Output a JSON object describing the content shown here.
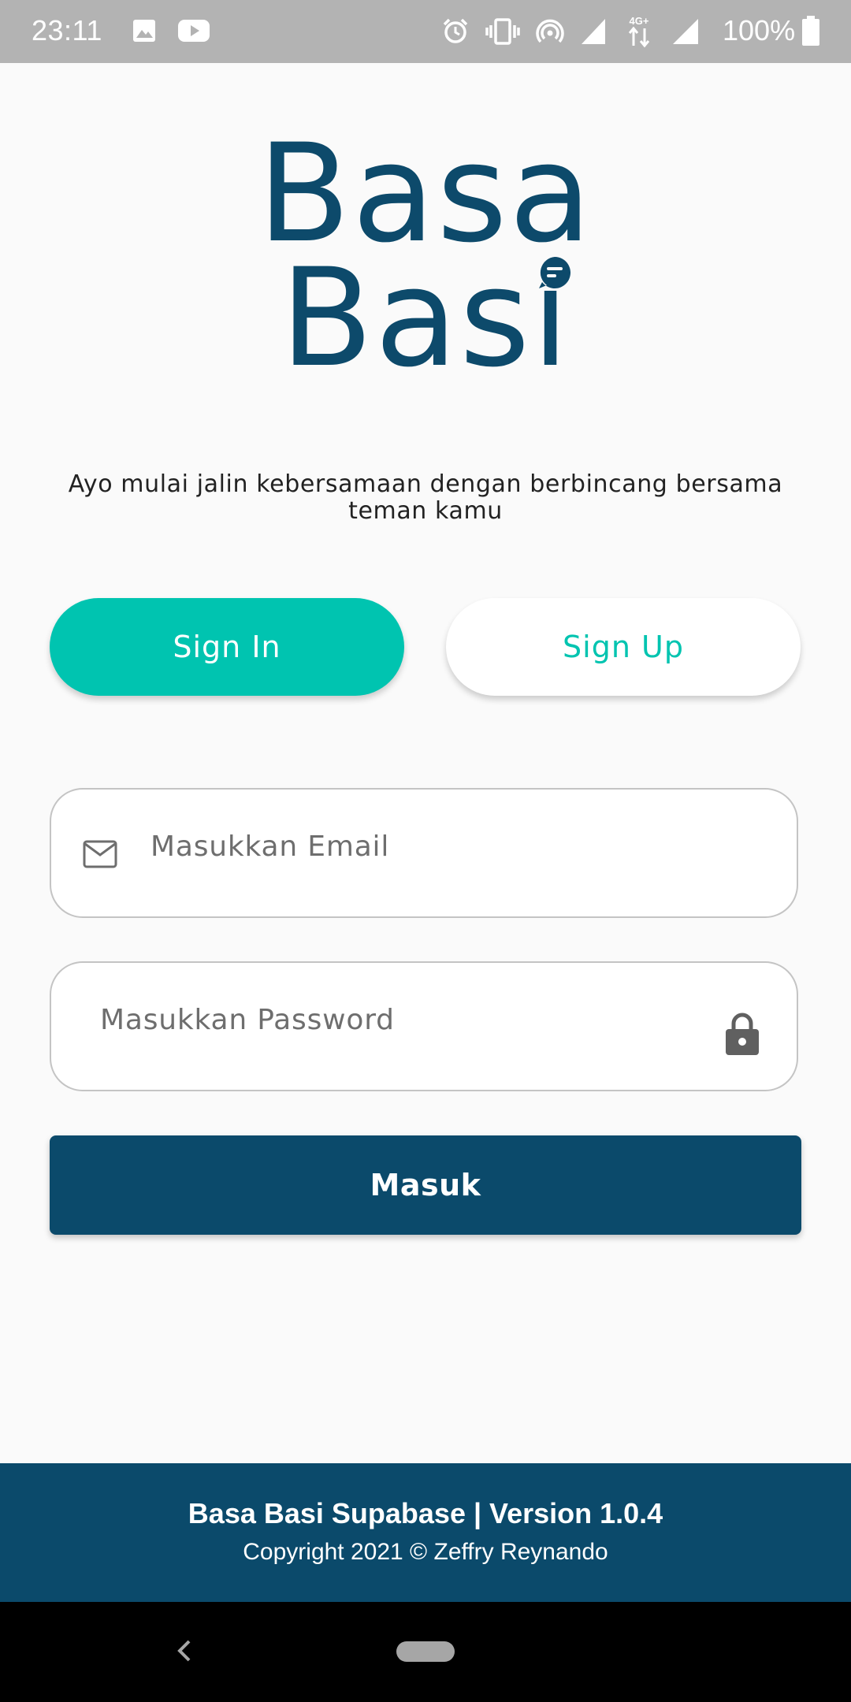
{
  "status_bar": {
    "time": "23:11",
    "battery": "100%",
    "network": "4G+",
    "icons": [
      "image-icon",
      "youtube-icon",
      "alarm-icon",
      "vibrate-icon",
      "hotspot-icon",
      "signal-icon",
      "data-arrows-icon",
      "signal-icon",
      "battery-icon"
    ]
  },
  "logo": {
    "line1": "Basa",
    "line2": "Basi"
  },
  "tagline": "Ayo mulai jalin kebersamaan dengan berbincang bersama teman kamu",
  "tabs": {
    "sign_in": "Sign In",
    "sign_up": "Sign Up",
    "active": "sign_in"
  },
  "form": {
    "email_placeholder": "Masukkan Email",
    "email_value": "",
    "password_placeholder": "Masukkan Password",
    "password_value": "",
    "submit_label": "Masuk"
  },
  "footer": {
    "title": "Basa Basi Supabase | Version 1.0.4",
    "copyright": "Copyright 2021 © Zeffry Reynando"
  },
  "colors": {
    "primary": "#0b4a6b",
    "accent": "#00c4b0",
    "background": "#fafafa"
  }
}
